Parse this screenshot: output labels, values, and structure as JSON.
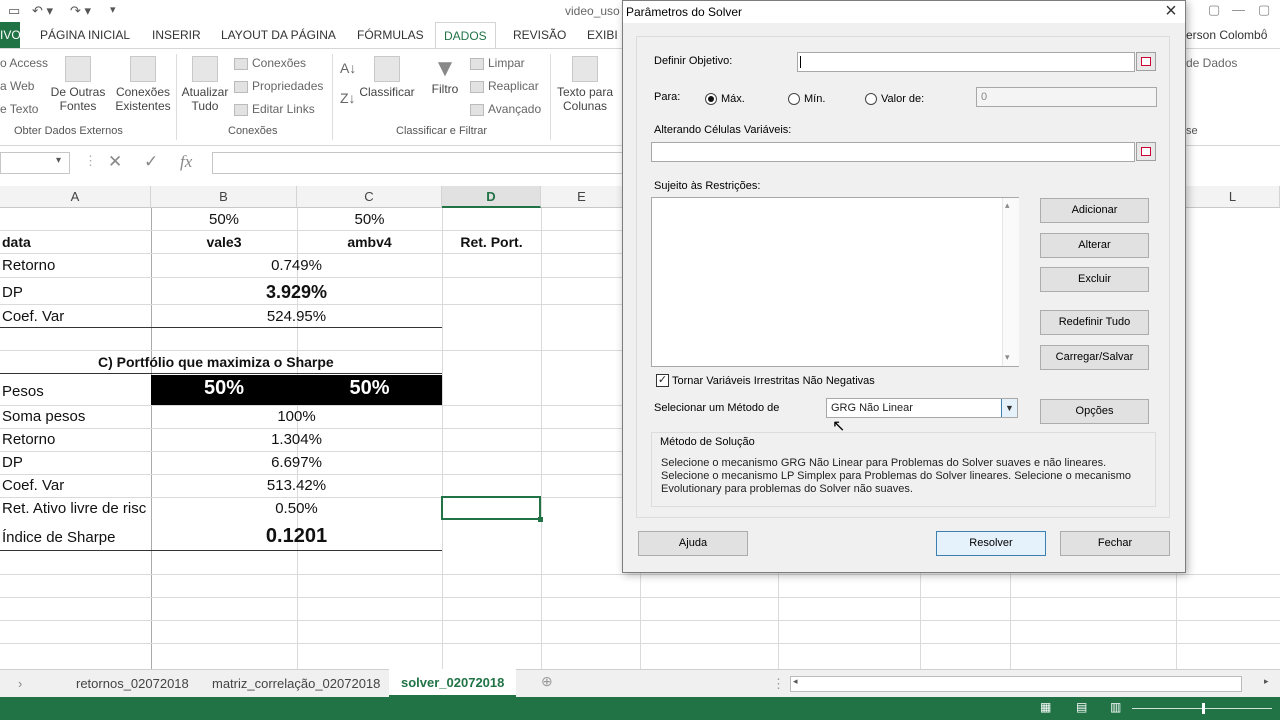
{
  "titlebar": {
    "doc_title": "video_uso",
    "undo_icon": "undo-icon",
    "redo_icon": "redo-icon"
  },
  "ribbon_tabs": {
    "file": "IVO",
    "items": [
      "PÁGINA INICIAL",
      "INSERIR",
      "LAYOUT DA PÁGINA",
      "FÓRMULAS",
      "DADOS",
      "REVISÃO",
      "EXIBI"
    ],
    "active": "DADOS",
    "user": "erson Colombo"
  },
  "ribbon": {
    "access": "o Access",
    "web": "a Web",
    "text": "e Texto",
    "other_sources": "De Outras",
    "other_sources2": "Fontes",
    "existing": "Conexões",
    "existing2": "Existentes",
    "group_external": "Obter Dados Externos",
    "refresh": "Atualizar",
    "refresh2": "Tudo",
    "connections": "Conexões",
    "properties": "Propriedades",
    "edit_links": "Editar Links",
    "group_connections": "Conexões",
    "sort": "Classificar",
    "filter": "Filtro",
    "clear": "Limpar",
    "reapply": "Reaplicar",
    "advanced": "Avançado",
    "group_sort": "Classificar e Filtrar",
    "text_to_cols": "Texto para",
    "text_to_cols2": "Colunas",
    "right_item": "de Dados",
    "right_group": "se"
  },
  "formula_bar": {
    "fx": "fx",
    "cancel": "✕",
    "enter": "✓"
  },
  "columns": [
    "A",
    "B",
    "C",
    "D",
    "E",
    "L"
  ],
  "sheet": {
    "weights_top": {
      "b": "50%",
      "c": "50%"
    },
    "headers": {
      "a": "data",
      "b": "vale3",
      "c": "ambv4",
      "d": "Ret. Port."
    },
    "retorno": {
      "label": "Retorno",
      "value": "0.749%"
    },
    "dp": {
      "label": "DP",
      "value": "3.929%"
    },
    "coef": {
      "label": "Coef. Var",
      "value": "524.95%"
    },
    "section_title": "C) Portfólio que maximiza o Sharpe",
    "pesos": {
      "label": "Pesos",
      "b": "50%",
      "c": "50%"
    },
    "soma": {
      "label": "Soma pesos",
      "value": "100%"
    },
    "retorno2": {
      "label": "Retorno",
      "value": "1.304%"
    },
    "dp2": {
      "label": "DP",
      "value": "6.697%"
    },
    "coef2": {
      "label": "Coef. Var",
      "value": "513.42%"
    },
    "rf": {
      "label": "Ret. Ativo livre de risc",
      "value": "0.50%"
    },
    "sharpe": {
      "label": "Índice de Sharpe",
      "value": "0.1201"
    }
  },
  "sheet_tabs": {
    "items": [
      "retornos_02072018",
      "matriz_correlação_02072018",
      "solver_02072018"
    ],
    "active": "solver_02072018"
  },
  "dialog": {
    "title": "Parâmetros do Solver",
    "objective_label": "Definir Objetivo:",
    "objective_value": "",
    "para_label": "Para:",
    "max": "Máx.",
    "min": "Mín.",
    "valor_de": "Valor de:",
    "valor_de_value": "0",
    "changing_label": "Alterando Células Variáveis:",
    "changing_value": "",
    "constraints_label": "Sujeito às Restrições:",
    "add": "Adicionar",
    "change": "Alterar",
    "delete": "Excluir",
    "reset": "Redefinir Tudo",
    "load_save": "Carregar/Salvar",
    "nonneg": "Tornar Variáveis Irrestritas Não Negativas",
    "nonneg_checked": true,
    "method_label": "Selecionar um Método de",
    "method_value": "GRG Não Linear",
    "options": "Opções",
    "solution_title": "Método de Solução",
    "solution_desc1": "Selecione o mecanismo GRG Não Linear para Problemas do Solver suaves e não lineares.",
    "solution_desc2": "Selecione o mecanismo LP Simplex para Problemas do Solver lineares. Selecione o mecanismo",
    "solution_desc3": "Evolutionary para problemas do Solver não suaves.",
    "help": "Ajuda",
    "solve": "Resolver",
    "close": "Fechar"
  }
}
